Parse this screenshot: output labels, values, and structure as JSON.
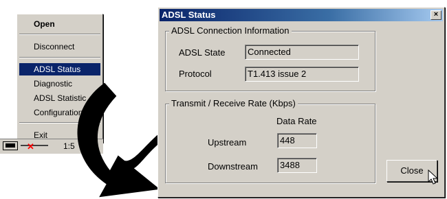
{
  "context_menu": {
    "items": [
      {
        "label": "Open"
      },
      {
        "label": "Disconnect"
      },
      {
        "label": "ADSL Status"
      },
      {
        "label": "Diagnostic"
      },
      {
        "label": "ADSL Statistic"
      },
      {
        "label": "Configuration"
      },
      {
        "label": "Exit"
      }
    ],
    "selected": "ADSL Status"
  },
  "tray": {
    "clock": "1:5"
  },
  "dialog": {
    "title": "ADSL Status",
    "close_x": "×",
    "connection_group": {
      "legend": "ADSL Connection Information",
      "state_label": "ADSL State",
      "state_value": "Connected",
      "protocol_label": "Protocol",
      "protocol_value": "T1.413 issue 2"
    },
    "rate_group": {
      "legend": "Transmit / Receive Rate  (Kbps)",
      "column_header": "Data Rate",
      "upstream_label": "Upstream",
      "upstream_value": "448",
      "downstream_label": "Downstream",
      "downstream_value": "3488"
    },
    "close_button": "Close"
  },
  "colors": {
    "face": "#d4d0c8",
    "selection": "#0a246a",
    "title_bar": "#0a246a"
  },
  "icons": [
    "network-tray-icon",
    "disconnected-x-icon",
    "curved-arrow-icon",
    "mouse-cursor-icon"
  ]
}
